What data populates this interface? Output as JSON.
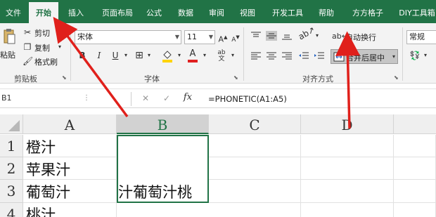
{
  "tabs": [
    "文件",
    "开始",
    "插入",
    "页面布局",
    "公式",
    "数据",
    "审阅",
    "视图",
    "开发工具",
    "帮助",
    "方方格子",
    "DIY工具箱"
  ],
  "clipboard": {
    "paste": "粘贴",
    "cut": "剪切",
    "copy": "复制",
    "format_painter": "格式刷",
    "group": "剪贴板"
  },
  "font": {
    "name": "宋体",
    "size": "11",
    "group": "字体",
    "bold": "B",
    "italic": "I",
    "underline": "U",
    "font_color_letter": "A"
  },
  "alignment": {
    "wrap_text": "自动换行",
    "merge_center": "合并后居中",
    "group": "对齐方式"
  },
  "number": {
    "format": "常规"
  },
  "formula_bar": {
    "name_box": "B1",
    "formula": "=PHONETIC(A1:A5)",
    "fx": "fx"
  },
  "columns": [
    "A",
    "B",
    "C",
    "D"
  ],
  "rows": [
    "1",
    "2",
    "3",
    "4"
  ],
  "cells": {
    "A1": "橙汁",
    "A2": "苹果汁",
    "A3": "葡萄汁",
    "A4": "桃汁",
    "B3": "汁葡萄汁桃"
  },
  "colors": {
    "brand": "#217346",
    "arrow": "#e0201b",
    "fill_highlight": "#ffd400",
    "font_red": "#e02020"
  }
}
